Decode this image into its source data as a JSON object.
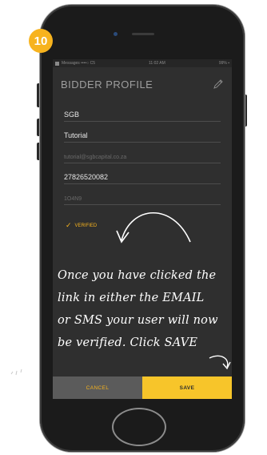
{
  "step_number": "10",
  "status_bar": {
    "carrier": "Messages ••••○ C5",
    "time": "11:02 AM",
    "battery": "99% ▪"
  },
  "header": {
    "title": "BIDDER PROFILE",
    "edit_icon": "pencil-icon"
  },
  "fields": [
    {
      "name": "first-name",
      "value": "SGB"
    },
    {
      "name": "last-name",
      "value": "Tutorial"
    },
    {
      "name": "email",
      "value": "tutorial@sgbcapital.co.za"
    },
    {
      "name": "phone",
      "value": "27826520082"
    },
    {
      "name": "otp",
      "value": "1O4N9"
    }
  ],
  "verified_label": "VERIFIED",
  "instruction_lines": [
    "Once you have clicked the",
    "link in either the EMAIL",
    "or SMS your user will now",
    "be verified. Click SAVE"
  ],
  "buttons": {
    "cancel_label": "CANCEL",
    "save_label": "SAVE"
  },
  "colors": {
    "accent": "#f7b31e",
    "screen_bg": "#2f2f2f",
    "cancel_bg": "#5b5b5b",
    "save_bg": "#f7c52a"
  }
}
